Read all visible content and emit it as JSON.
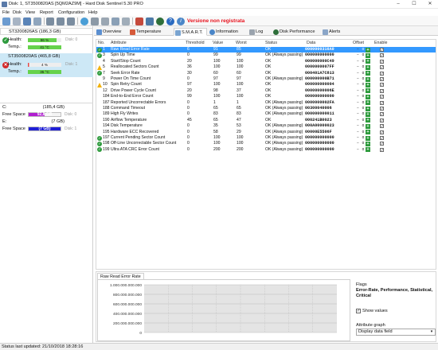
{
  "window": {
    "title": "Disk: 1, ST3500820AS [5QM2AZ9M]  -  Hard Disk Sentinel 5.30 PRO",
    "minimize": "–",
    "maximize": "☐",
    "close": "✕"
  },
  "menu": [
    "File",
    "Disk",
    "View",
    "Report",
    "Configuration",
    "Help"
  ],
  "toolbar": {
    "warning": "Versione non registrata",
    "icons": [
      "refresh-icon",
      "report-icon",
      "save-icon",
      "send-icon",
      "disk-icon",
      "disk-add-icon",
      "disk-remove-icon",
      "disk-tools-icon",
      "globe-icon",
      "drive-icon",
      "test-icon",
      "chart-icon",
      "power-icon",
      "help-icon",
      "info-icon"
    ]
  },
  "disks": [
    {
      "name": "ST3200826AS (186,3 GB)",
      "status": "ok",
      "health_label": "Health:",
      "health_value": "86 %",
      "health_level": 0.86,
      "health_color": "#66d24c",
      "temp_label": "Temp.:",
      "temp_value": "41 °C",
      "temp_color": "#66d24c",
      "disk_tag": "Disk: 0"
    },
    {
      "name": "ST3500820AS (465,8 GB)",
      "status": "bad",
      "health_label": "Health:",
      "health_value": "4 %",
      "health_level": 0.04,
      "health_color": "#e34b4b",
      "temp_label": "Temp.:",
      "temp_value": "35 °C",
      "temp_color": "#66d24c",
      "disk_tag": "Disk: 1"
    }
  ],
  "volumes": [
    {
      "letter": "C:",
      "size": "(185,4 GB)",
      "free_label": "Free Space",
      "free_value": "92,8 GB",
      "free_level": 0.5,
      "color": "#b01ed0",
      "disk_tag": "Disk: 0"
    },
    {
      "letter": "E:",
      "size": "(7 GB)",
      "free_label": "Free Space",
      "free_value": "(7 GB)",
      "free_level": 1.0,
      "color": "#1f1fd6",
      "disk_tag": "Disk: 1"
    }
  ],
  "tabs": [
    {
      "label": "Overview",
      "icon": "overview-icon"
    },
    {
      "label": "Temperature",
      "icon": "temperature-icon"
    },
    {
      "label": "S.M.A.R.T.",
      "icon": "smart-icon"
    },
    {
      "label": "Information",
      "icon": "information-icon"
    },
    {
      "label": "Log",
      "icon": "log-icon"
    },
    {
      "label": "Disk Performance",
      "icon": "performance-icon"
    },
    {
      "label": "Alerts",
      "icon": "alerts-icon"
    }
  ],
  "smart": {
    "headers": {
      "no": "No.",
      "attribute": "Attribute",
      "threshold": "Threshold",
      "value": "Value",
      "worst": "Worst",
      "status": "Status",
      "data": "Data",
      "offset": "Offset",
      "enable": "Enable"
    },
    "rows": [
      {
        "no": "1",
        "attribute": "Raw Read Error Rate",
        "threshold": "6",
        "value": "91",
        "worst": "85",
        "status": "OK",
        "data": "0000000316A0",
        "icon": "ok",
        "selected": true
      },
      {
        "no": "3",
        "attribute": "Spin Up Time",
        "threshold": "0",
        "value": "99",
        "worst": "99",
        "status": "OK (Always passing)",
        "data": "000000000000",
        "icon": "ok",
        "selected": false
      },
      {
        "no": "4",
        "attribute": "Start/Stop Count",
        "threshold": "20",
        "value": "100",
        "worst": "100",
        "status": "OK",
        "data": "000000000C49",
        "icon": "none",
        "selected": false
      },
      {
        "no": "5",
        "attribute": "Reallocated Sectors Count",
        "threshold": "36",
        "value": "100",
        "worst": "100",
        "status": "OK",
        "data": "0000000007FF",
        "icon": "warn",
        "selected": false
      },
      {
        "no": "7",
        "attribute": "Seek Error Rate",
        "threshold": "30",
        "value": "60",
        "worst": "60",
        "status": "OK",
        "data": "000401A7C813",
        "icon": "ok",
        "selected": false
      },
      {
        "no": "9",
        "attribute": "Power On Time Count",
        "threshold": "0",
        "value": "97",
        "worst": "97",
        "status": "OK (Always passing)",
        "data": "000000000B71",
        "icon": "none",
        "selected": false
      },
      {
        "no": "10",
        "attribute": "Spin Retry Count",
        "threshold": "97",
        "value": "100",
        "worst": "100",
        "status": "OK",
        "data": "000000000004",
        "icon": "warn",
        "selected": false
      },
      {
        "no": "12",
        "attribute": "Drive Power Cycle Count",
        "threshold": "20",
        "value": "98",
        "worst": "37",
        "status": "OK",
        "data": "00000000006E",
        "icon": "none",
        "selected": false
      },
      {
        "no": "184",
        "attribute": "End-to-End Error Count",
        "threshold": "99",
        "value": "100",
        "worst": "100",
        "status": "OK",
        "data": "000000000000",
        "icon": "none",
        "selected": false
      },
      {
        "no": "187",
        "attribute": "Reported Uncorrectable Errors",
        "threshold": "0",
        "value": "1",
        "worst": "1",
        "status": "OK (Always passing)",
        "data": "0000000002FA",
        "icon": "none",
        "selected": false
      },
      {
        "no": "188",
        "attribute": "Command Timeout",
        "threshold": "0",
        "value": "65",
        "worst": "65",
        "status": "OK (Always passing)",
        "data": "00300040006",
        "icon": "none",
        "selected": false
      },
      {
        "no": "189",
        "attribute": "High Fly Writes",
        "threshold": "0",
        "value": "83",
        "worst": "83",
        "status": "OK (Always passing)",
        "data": "000000000011",
        "icon": "none",
        "selected": false
      },
      {
        "no": "190",
        "attribute": "Airflow Temperature",
        "threshold": "45",
        "value": "65",
        "worst": "47",
        "status": "OK",
        "data": "000241B0023",
        "icon": "none",
        "selected": false
      },
      {
        "no": "194",
        "attribute": "Disk Temperature",
        "threshold": "0",
        "value": "35",
        "worst": "53",
        "status": "OK (Always passing)",
        "data": "000A00000023",
        "icon": "none",
        "selected": false
      },
      {
        "no": "195",
        "attribute": "Hardware ECC Recovered",
        "threshold": "0",
        "value": "58",
        "worst": "29",
        "status": "OK (Always passing)",
        "data": "00000E5506F",
        "icon": "none",
        "selected": false
      },
      {
        "no": "197",
        "attribute": "Current Pending Sector Count",
        "threshold": "0",
        "value": "100",
        "worst": "100",
        "status": "OK (Always passing)",
        "data": "000000000000",
        "icon": "ok",
        "selected": false
      },
      {
        "no": "198",
        "attribute": "Off-Line Uncorrectable Sector Count",
        "threshold": "0",
        "value": "100",
        "worst": "100",
        "status": "OK (Always passing)",
        "data": "000000000000",
        "icon": "ok",
        "selected": false
      },
      {
        "no": "199",
        "attribute": "Ultra ATA CRC Error Count",
        "threshold": "0",
        "value": "200",
        "worst": "200",
        "status": "OK (Always passing)",
        "data": "000000000000",
        "icon": "ok",
        "selected": false
      }
    ],
    "offset_value": "0"
  },
  "bottom": {
    "tab_label": "Raw Read Error Rate",
    "flags_label": "Flags",
    "flags_value": "Error-Rate, Performance, Statistical, Critical",
    "show_values_label": "Show values",
    "show_values_checked": true,
    "attribute_graph_label": "Attribute graph",
    "attribute_graph_value": "Display data field"
  },
  "chart_data": {
    "type": "line",
    "title": "",
    "xlabel": "",
    "ylabel": "",
    "yticks": [
      "1.000.000.000.000",
      "800.000.000.000",
      "600.000.000.000",
      "400.000.000.000",
      "200.000.000.000",
      "0"
    ],
    "ylim": [
      0,
      1000000000000
    ],
    "series": [],
    "grid": true
  },
  "status": {
    "text": "Status last updated: 21/10/2018 18:28:16"
  }
}
